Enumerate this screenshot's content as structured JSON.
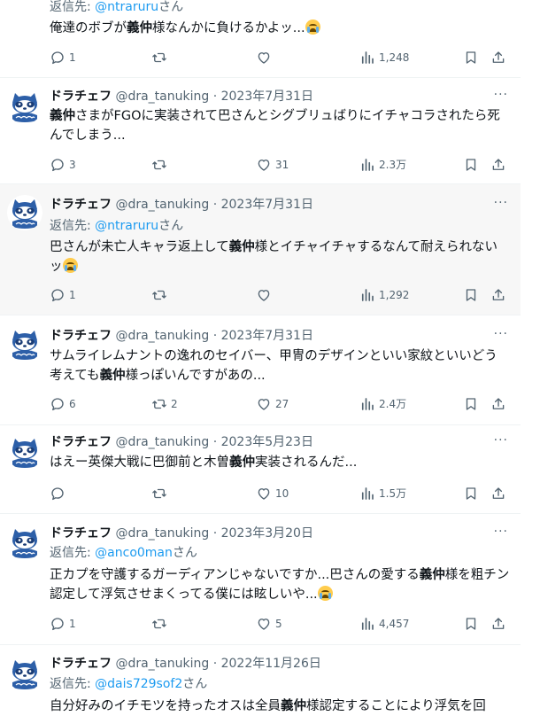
{
  "tweets": [
    {
      "reply_prefix": "返信先: ",
      "reply_handle": "@ntraruru",
      "reply_suffix": "さん",
      "text_parts": [
        "俺達のボブが",
        "義仲",
        "様なんかに負けるかよッ..."
      ],
      "replies": "1",
      "retweets": "",
      "likes": "",
      "views": "1,248"
    },
    {
      "name": "ドラチェフ",
      "handle": "@dra_tanuking",
      "sep": " · ",
      "date": "2023年7月31日",
      "text_parts": [
        "",
        "義仲",
        "さまがFGOに実装されて巴さんとシグブリュばりにイチャコラされたら死んでしまう..."
      ],
      "replies": "3",
      "retweets": "",
      "likes": "31",
      "views": "2.3万"
    },
    {
      "name": "ドラチェフ",
      "handle": "@dra_tanuking",
      "sep": " · ",
      "date": "2023年7月31日",
      "reply_prefix": "返信先: ",
      "reply_handle": "@ntraruru",
      "reply_suffix": "さん",
      "text_parts": [
        "巴さんが未亡人キャラ返上して",
        "義仲",
        "様とイチャイチャするなんて耐えられないッ"
      ],
      "replies": "1",
      "retweets": "",
      "likes": "",
      "views": "1,292"
    },
    {
      "name": "ドラチェフ",
      "handle": "@dra_tanuking",
      "sep": " · ",
      "date": "2023年7月31日",
      "text_parts": [
        "サムライレムナントの逸れのセイバー、甲冑のデザインといい家紋といいどう考えても",
        "義仲",
        "様っぽいんですがあの..."
      ],
      "replies": "6",
      "retweets": "2",
      "likes": "27",
      "views": "2.4万"
    },
    {
      "name": "ドラチェフ",
      "handle": "@dra_tanuking",
      "sep": " · ",
      "date": "2023年5月23日",
      "text_parts": [
        "はえー英傑大戦に巴御前と木曽",
        "義仲",
        "実装されるんだ..."
      ],
      "replies": "",
      "retweets": "",
      "likes": "10",
      "views": "1.5万"
    },
    {
      "name": "ドラチェフ",
      "handle": "@dra_tanuking",
      "sep": " · ",
      "date": "2023年3月20日",
      "reply_prefix": "返信先: ",
      "reply_handle": "@anco0man",
      "reply_suffix": "さん",
      "text_parts": [
        "正カプを守護するガーディアンじゃないですか...巴さんの愛する",
        "義仲",
        "様を粗チン認定して浮気させまくってる僕には眩しいや..."
      ],
      "replies": "1",
      "retweets": "",
      "likes": "5",
      "views": "4,457"
    },
    {
      "name": "ドラチェフ",
      "handle": "@dra_tanuking",
      "sep": " · ",
      "date": "2022年11月26日",
      "reply_prefix": "返信先: ",
      "reply_handle": "@dais729sof2",
      "reply_suffix": "さん",
      "text_parts": [
        "自分好みのイチモツを持ったオスは全員",
        "義仲",
        "様認定することにより浮気を回"
      ]
    }
  ],
  "more_label": "···",
  "colors": {
    "accent": "#1d9bf0",
    "secondary": "#536471",
    "text": "#0f1419",
    "highlight_bg": "#f7f7f7"
  },
  "icons": [
    "reply-icon",
    "retweet-icon",
    "like-icon",
    "views-icon",
    "bookmark-icon",
    "share-icon",
    "more-icon",
    "crying-emoji-icon"
  ]
}
